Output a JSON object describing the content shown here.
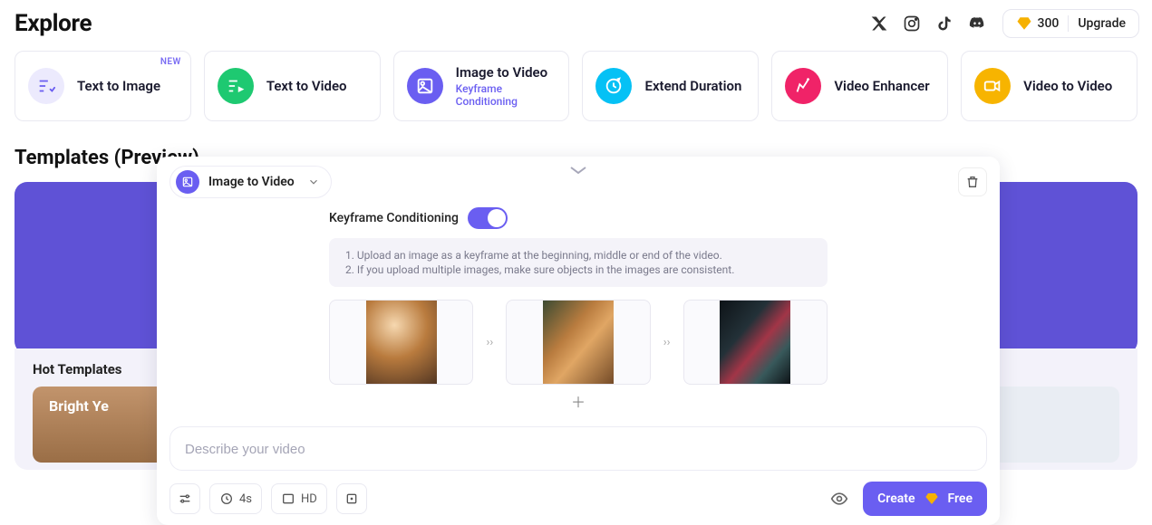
{
  "header": {
    "title": "Explore",
    "credits": "300",
    "upgrade_label": "Upgrade"
  },
  "modes": {
    "text_to_image": "Text to Image",
    "new_badge": "NEW",
    "text_to_video": "Text to Video",
    "image_to_video": "Image to Video",
    "image_to_video_sub": "Keyframe Conditioning",
    "extend_duration": "Extend Duration",
    "video_enhancer": "Video Enhancer",
    "video_to_video": "Video to Video"
  },
  "templates": {
    "section_title": "Templates (Preview)",
    "hot_title": "Hot Templates",
    "thumb1_label": "Bright Ye"
  },
  "modal": {
    "selector_label": "Image to Video",
    "kf_label": "Keyframe Conditioning",
    "hint1": "Upload an image as a keyframe at the beginning, middle or end of the video.",
    "hint2": "If you upload multiple images, make sure objects in the images are consistent.",
    "prompt_placeholder": "Describe your video",
    "duration_label": "4s",
    "quality_label": "HD",
    "create_label": "Create",
    "free_label": "Free"
  }
}
